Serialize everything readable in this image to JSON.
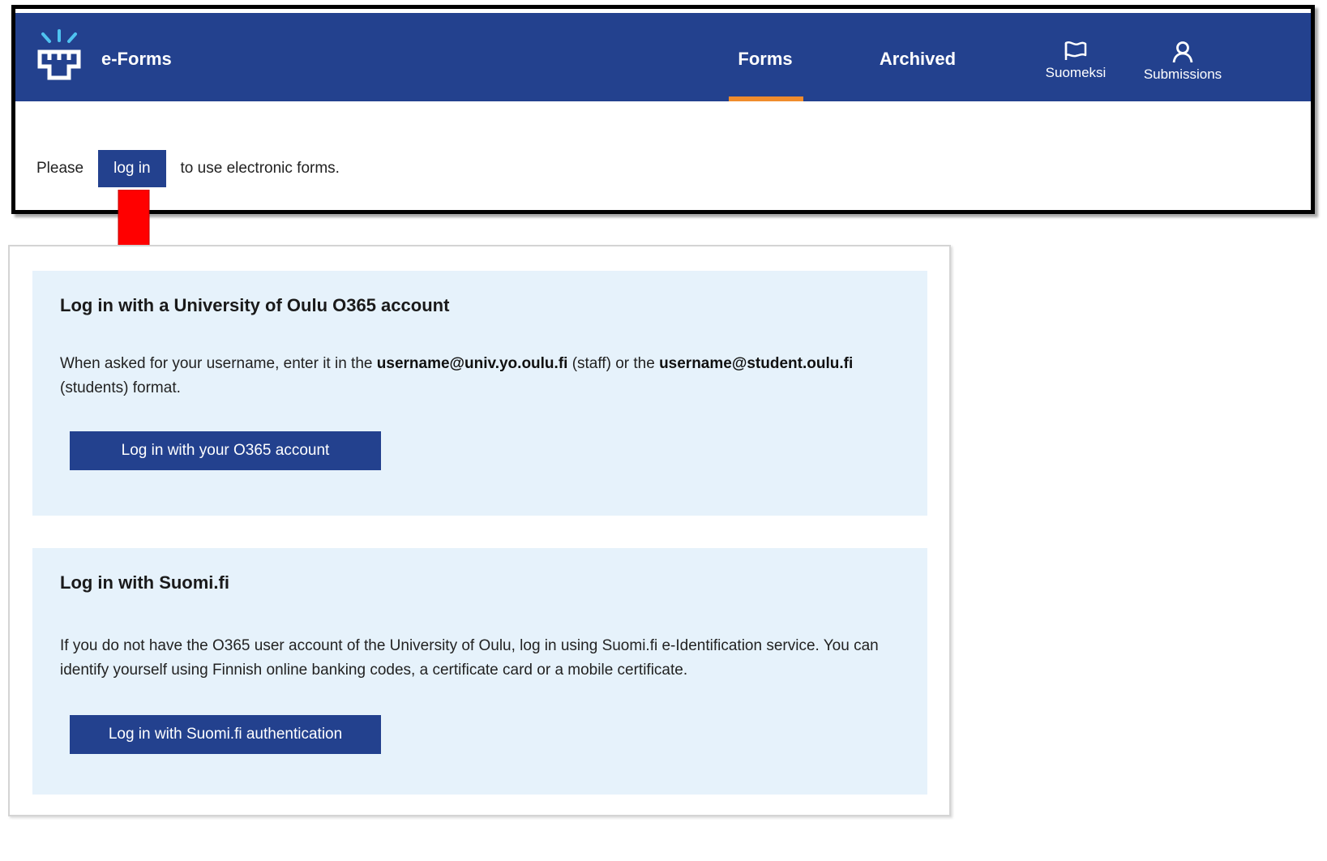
{
  "app": {
    "brand": "e-Forms"
  },
  "nav": {
    "forms": "Forms",
    "archived": "Archived",
    "suomeksi": "Suomeksi",
    "submissions": "Submissions"
  },
  "login_prompt": {
    "before": "Please",
    "button": "log in",
    "after": "to use electronic forms."
  },
  "o365": {
    "title": "Log in with a University of Oulu O365 account",
    "text_1": "When asked for your username, enter it in the ",
    "staff_format": "username@univ.yo.oulu.fi",
    "text_2": " (staff) or the ",
    "student_format": "username@student.oulu.fi",
    "text_3": " (students) format.",
    "button": "Log in with your O365 account"
  },
  "suomifi": {
    "title": "Log in with Suomi.fi",
    "text": "If you do not have the O365 user account of the University of Oulu, log in using Suomi.fi e-Identification service. You can identify yourself using Finnish online banking codes, a certificate card or a mobile certificate.",
    "button": "Log in with Suomi.fi authentication"
  },
  "colors": {
    "primary": "#23418e",
    "accent_underline": "#f08c2d",
    "card_bg": "#e6f2fb",
    "arrow": "#ff0000"
  },
  "icons": {
    "logo": "university-of-oulu-logo-icon",
    "suomeksi": "flag-icon",
    "submissions": "user-icon"
  }
}
